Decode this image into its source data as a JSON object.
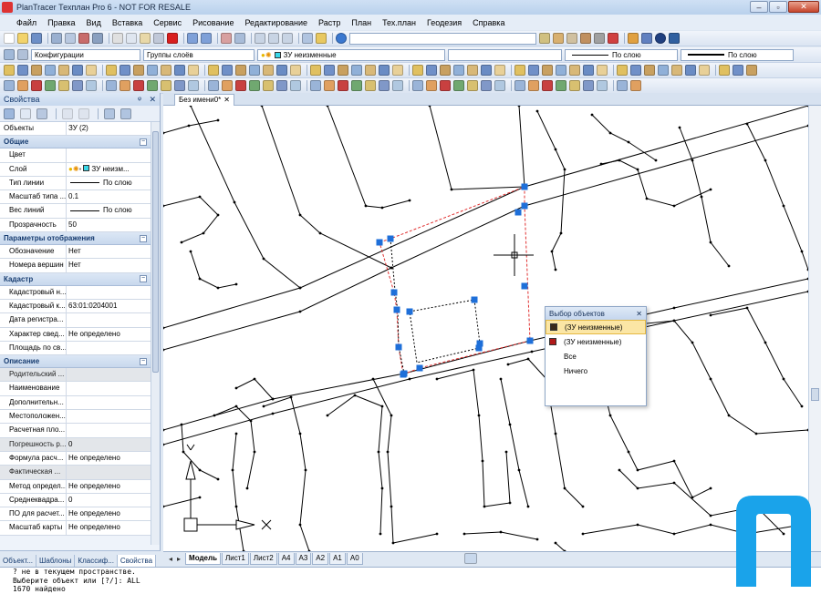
{
  "window": {
    "title": "PlanTracer Техплан Pro 6 - NOT FOR RESALE",
    "minimize": "–",
    "maximize": "▫",
    "close": "✕"
  },
  "menu": [
    "Файл",
    "Правка",
    "Вид",
    "Вставка",
    "Сервис",
    "Рисование",
    "Редактирование",
    "Растр",
    "План",
    "Тех.план",
    "Геодезия",
    "Справка"
  ],
  "toolbar2": {
    "config_label": "Конфигурации",
    "layer_groups_label": "Группы слоёв",
    "layer_label": "ЗУ неизменные",
    "linetype_label": "По слою",
    "lineweight_label": "По слою"
  },
  "properties": {
    "title": "Свойства",
    "pin": "ᵠ",
    "close": "✕",
    "objects_key": "Объекты",
    "objects_value": "ЗУ (2)",
    "sections": [
      {
        "name": "Общие",
        "rows": [
          {
            "k": "Цвет",
            "v": ""
          },
          {
            "k": "Слой",
            "v": "ЗУ неизм..."
          },
          {
            "k": "Тип линии",
            "v": "По слою",
            "line": true
          },
          {
            "k": "Масштаб типа ...",
            "v": "0.1"
          },
          {
            "k": "Вес линий",
            "v": "По слою",
            "line": true
          },
          {
            "k": "Прозрачность",
            "v": "50"
          }
        ]
      },
      {
        "name": "Параметры отображения",
        "rows": [
          {
            "k": "Обозначение",
            "v": "Нет"
          },
          {
            "k": "Номера вершин",
            "v": "Нет"
          }
        ]
      },
      {
        "name": "Кадастр",
        "rows": [
          {
            "k": "Кадастровый н...",
            "v": ""
          },
          {
            "k": "Кадастровый к...",
            "v": "63:01:0204001"
          },
          {
            "k": "Дата регистра...",
            "v": ""
          },
          {
            "k": "Характер свед...",
            "v": "Не определено"
          },
          {
            "k": "Площадь по св...",
            "v": ""
          }
        ]
      },
      {
        "name": "Описание",
        "rows": [
          {
            "k": "Родительский ...",
            "v": "",
            "dim": true
          },
          {
            "k": "Наименование",
            "v": ""
          },
          {
            "k": "Дополнительн...",
            "v": ""
          },
          {
            "k": "Местоположен...",
            "v": ""
          },
          {
            "k": "Расчетная пло...",
            "v": ""
          },
          {
            "k": "Погрешность р...",
            "v": "0",
            "dim": true
          },
          {
            "k": "Формула расч...",
            "v": "Не определено"
          },
          {
            "k": "Фактическая ...",
            "v": "",
            "dim": true
          },
          {
            "k": "Метод определ...",
            "v": "Не определено"
          },
          {
            "k": "Среднеквадра...",
            "v": "0"
          },
          {
            "k": "ПО для расчет...",
            "v": "Не определено"
          },
          {
            "k": "Масштаб карты",
            "v": "Не определено"
          }
        ]
      }
    ],
    "tabs": [
      "Объект...",
      "Шаблоны",
      "Классиф...",
      "Свойства"
    ]
  },
  "document": {
    "tab_label": "Без имени0*",
    "tab_close": "✕"
  },
  "layout_tabs": [
    "Модель",
    "Лист1",
    "Лист2",
    "А4",
    "А3",
    "А2",
    "А1",
    "А0"
  ],
  "layout_nav": [
    "◂",
    "▸"
  ],
  "popup": {
    "title": "Выбор объектов",
    "close": "✕",
    "items": [
      {
        "label": "(ЗУ неизменные)",
        "color": "#3a2a1a",
        "highlight": true
      },
      {
        "label": "(ЗУ неизменные)",
        "color": "#b01a1a",
        "highlight": false
      },
      {
        "label": "Все",
        "color": "",
        "highlight": false
      },
      {
        "label": "Ничего",
        "color": "",
        "highlight": false
      }
    ]
  },
  "command_line": [
    "? не в текущем пространстве.",
    "Выберите объект или [?/]: ALL",
    "1670 найдено"
  ],
  "colors": {
    "grip": "#1e6fd9",
    "selection_dash": "#e03030",
    "logo": "#1aa3ea"
  }
}
